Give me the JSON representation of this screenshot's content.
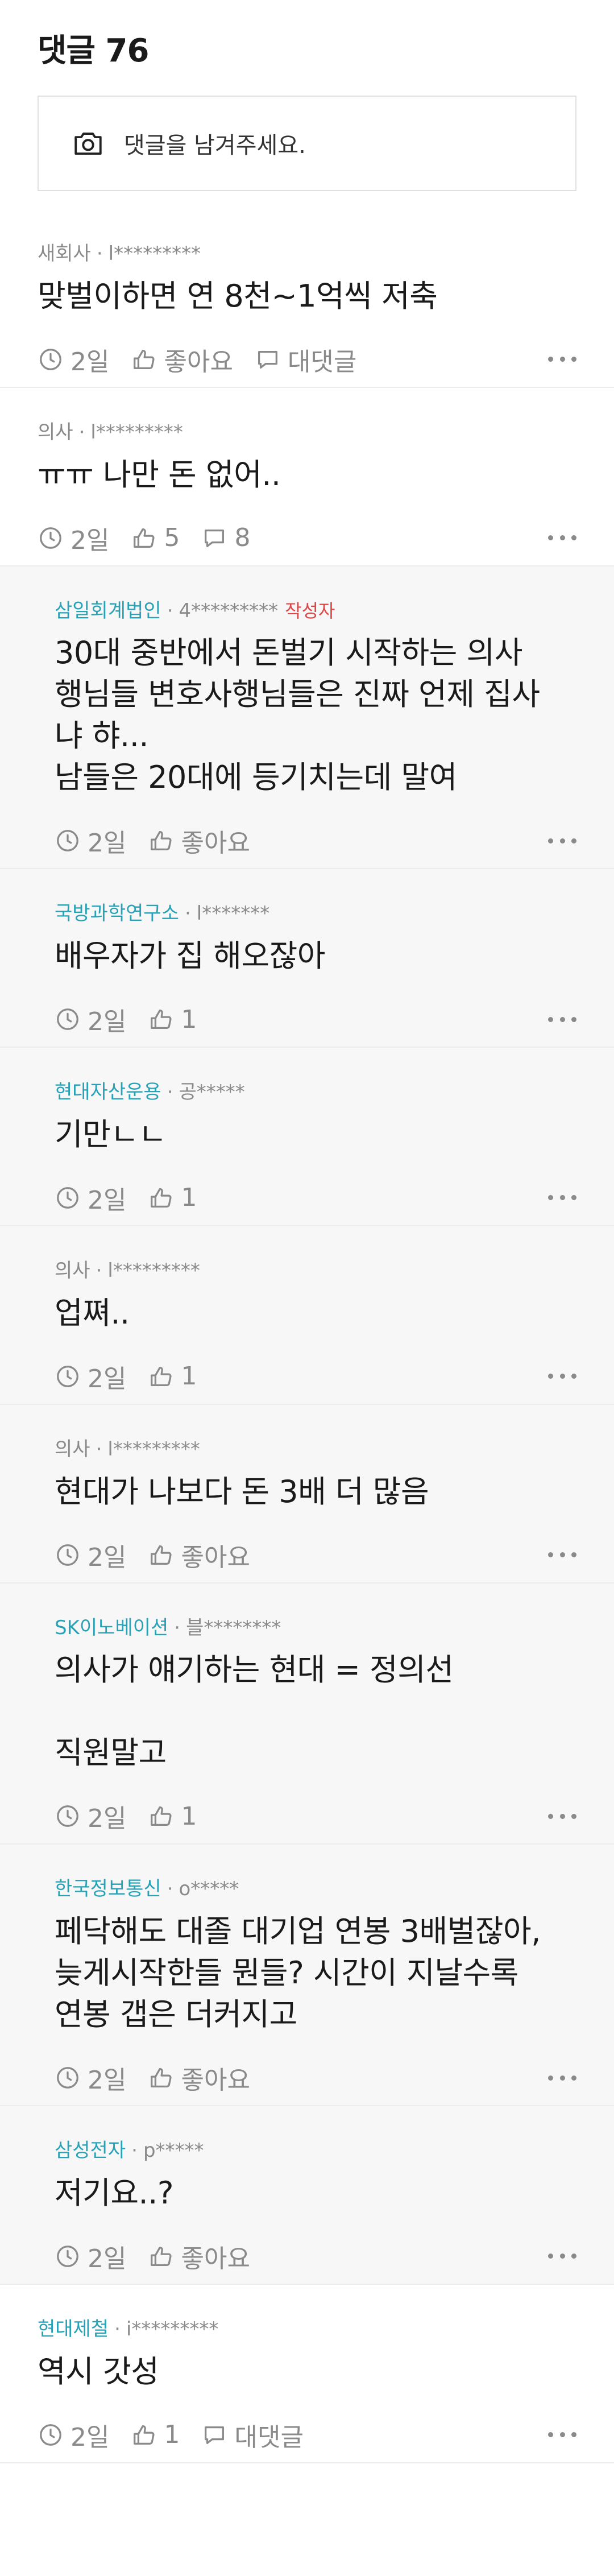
{
  "header": {
    "title": "댓글 76"
  },
  "composer": {
    "placeholder": "댓글을 남겨주세요.",
    "icon": "camera-icon"
  },
  "comments": [
    {
      "company": "새회사",
      "user": "l*********",
      "text": [
        "맞벌이하면 연 8천~1억씩 저축"
      ],
      "time": "2일",
      "likes": "좋아요",
      "reply_label": "대댓글",
      "reply": false
    },
    {
      "company": "의사",
      "user": "l*********",
      "text": [
        "ㅠㅠ 나만 돈 없어.."
      ],
      "time": "2일",
      "likes": "5",
      "replies": "8",
      "reply": false
    },
    {
      "company": "삼일회계법인",
      "user": "4*********",
      "author_tag": "작성자",
      "text": [
        "30대 중반에서 돈벌기 시작하는 의사",
        "행님들 변호사행님들은 진짜 언제 집사",
        "냐 햐...",
        "남들은 20대에 등기치는데 말여"
      ],
      "time": "2일",
      "likes": "좋아요",
      "reply": true
    },
    {
      "company": "국방과학연구소",
      "user": "l*******",
      "text": [
        "배우자가 집 해오잖아"
      ],
      "time": "2일",
      "likes": "1",
      "reply": true
    },
    {
      "company": "현대자산운용",
      "user": "공*****",
      "text": [
        "기만ㄴㄴ"
      ],
      "time": "2일",
      "likes": "1",
      "reply": true
    },
    {
      "company": "의사",
      "user": "l*********",
      "text": [
        "업쪄.."
      ],
      "time": "2일",
      "likes": "1",
      "reply": true,
      "gray_company": true
    },
    {
      "company": "의사",
      "user": "l*********",
      "text": [
        "현대가 나보다 돈 3배 더 많음"
      ],
      "time": "2일",
      "likes": "좋아요",
      "reply": true,
      "gray_company": true
    },
    {
      "company": "SK이노베이션",
      "user": "블********",
      "text": [
        "의사가 얘기하는 현대 = 정의선",
        "",
        "직원말고"
      ],
      "time": "2일",
      "likes": "1",
      "reply": true
    },
    {
      "company": "한국정보통신",
      "user": "o*****",
      "text": [
        "페닥해도 대졸 대기업 연봉 3배벌잖아,",
        "늦게시작한들 뭔들? 시간이 지날수록",
        "연봉 갭은 더커지고"
      ],
      "time": "2일",
      "likes": "좋아요",
      "reply": true
    },
    {
      "company": "삼성전자",
      "user": "p*****",
      "text": [
        "저기요..?"
      ],
      "time": "2일",
      "likes": "좋아요",
      "reply": true
    },
    {
      "company": "현대제철",
      "user": "i*********",
      "text": [
        "역시 갓성"
      ],
      "time": "2일",
      "likes": "1",
      "reply_label": "대댓글",
      "reply": false,
      "teal_company": true
    }
  ],
  "colors": {
    "accent": "#27a2b6",
    "author_tag": "#e04646",
    "muted": "#8a8a8a",
    "reply_bg": "#f7f7f7"
  }
}
